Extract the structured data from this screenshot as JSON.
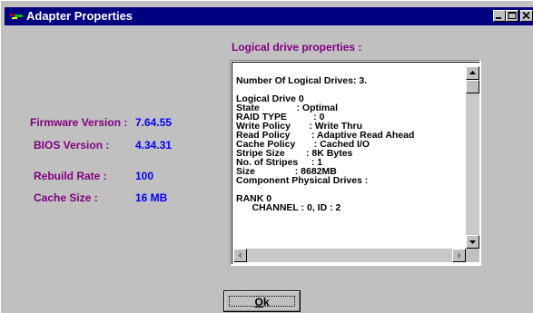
{
  "window": {
    "title": "Adapter Properties",
    "controls": [
      "minimize",
      "maximize",
      "close"
    ]
  },
  "adapter_info": [
    {
      "label": "Firmware Version :",
      "value": "7.64.55"
    },
    {
      "label": "BIOS Version :",
      "value": "4.34.31"
    },
    {
      "label": "Rebuild Rate :",
      "value": "100"
    },
    {
      "label": "Cache Size :",
      "value": "16 MB"
    }
  ],
  "logical_drive_section": {
    "title": "Logical drive properties :",
    "lines": [
      "",
      "Number Of Logical Drives: 3.",
      "",
      "Logical Drive 0",
      "State              : Optimal",
      "RAID TYPE          : 0",
      "Write Policy       : Write Thru",
      "Read Policy        : Adaptive Read Ahead",
      "Cache Policy       : Cached I/O",
      "Stripe Size        : 8K Bytes",
      "No. of Stripes     : 1",
      "Size               : 8682MB",
      "Component Physical Drives :",
      "",
      "RANK 0",
      "      CHANNEL : 0, ID : 2"
    ]
  },
  "ok_button": {
    "label": "Ok"
  },
  "icons": {
    "app": "adapter-app-icon",
    "minimize": "minimize-icon",
    "maximize": "maximize-icon",
    "close": "close-icon",
    "scroll_up": "arrow-up-icon",
    "scroll_down": "arrow-down-icon",
    "scroll_left": "arrow-left-icon",
    "scroll_right": "arrow-right-icon"
  },
  "colors": {
    "title_bar": "#000080",
    "label": "#800080",
    "value": "#0000ff",
    "face": "#c0c0c0"
  }
}
